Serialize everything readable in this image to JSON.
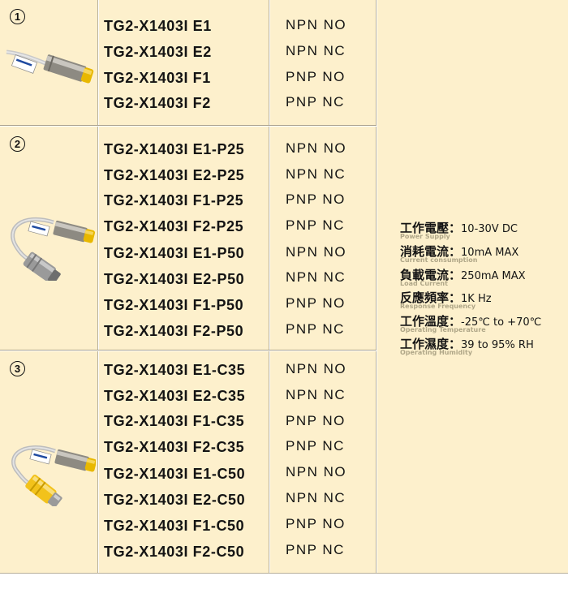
{
  "groups": [
    {
      "number": "1",
      "image": "sensor-with-cable-icon",
      "rows": [
        {
          "model": "TG2-X1403I E1",
          "output": "NPN NO"
        },
        {
          "model": "TG2-X1403I E2",
          "output": "NPN NC"
        },
        {
          "model": "TG2-X1403I F1",
          "output": "PNP NO"
        },
        {
          "model": "TG2-X1403I F2",
          "output": "PNP NC"
        }
      ]
    },
    {
      "number": "2",
      "image": "sensor-with-gray-connector-icon",
      "rows": [
        {
          "model": "TG2-X1403I E1-P25",
          "output": "NPN NO"
        },
        {
          "model": "TG2-X1403I E2-P25",
          "output": "NPN NC"
        },
        {
          "model": "TG2-X1403I F1-P25",
          "output": "PNP NO"
        },
        {
          "model": "TG2-X1403I F2-P25",
          "output": "PNP NC"
        },
        {
          "model": "TG2-X1403I E1-P50",
          "output": "NPN NO"
        },
        {
          "model": "TG2-X1403I E2-P50",
          "output": "NPN NC"
        },
        {
          "model": "TG2-X1403I F1-P50",
          "output": "PNP NO"
        },
        {
          "model": "TG2-X1403I F2-P50",
          "output": "PNP NC"
        }
      ]
    },
    {
      "number": "3",
      "image": "sensor-with-yellow-connector-icon",
      "rows": [
        {
          "model": "TG2-X1403I E1-C35",
          "output": "NPN NO"
        },
        {
          "model": "TG2-X1403I E2-C35",
          "output": "NPN NC"
        },
        {
          "model": "TG2-X1403I F1-C35",
          "output": "PNP NO"
        },
        {
          "model": "TG2-X1403I F2-C35",
          "output": "PNP NC"
        },
        {
          "model": "TG2-X1403I E1-C50",
          "output": "NPN NO"
        },
        {
          "model": "TG2-X1403I E2-C50",
          "output": "NPN NC"
        },
        {
          "model": "TG2-X1403I F1-C50",
          "output": "PNP NO"
        },
        {
          "model": "TG2-X1403I F2-C50",
          "output": "PNP NC"
        }
      ]
    }
  ],
  "specs": [
    {
      "label": "工作電壓",
      "value": "10-30V DC",
      "english": "Power Supply"
    },
    {
      "label": "消耗電流",
      "value": "10mA MAX",
      "english": "Current consumption"
    },
    {
      "label": "負載電流",
      "value": "250mA MAX",
      "english": "Load Current"
    },
    {
      "label": "反應頻率",
      "value": "1K Hz",
      "english": "Response Frequency"
    },
    {
      "label": "工作溫度",
      "value": "-25℃ to +70℃",
      "english": "Operating Temperature"
    },
    {
      "label": "工作濕度",
      "value": "39 to 95% RH",
      "english": "Operating Humidity"
    }
  ],
  "colors": {
    "background": "#fdf0cc",
    "border": "#b8b09a",
    "text": "#141414",
    "english_caption": "#b0a788",
    "sensor_cap": "#e8b800",
    "connector_yellow": "#f2c21b"
  }
}
